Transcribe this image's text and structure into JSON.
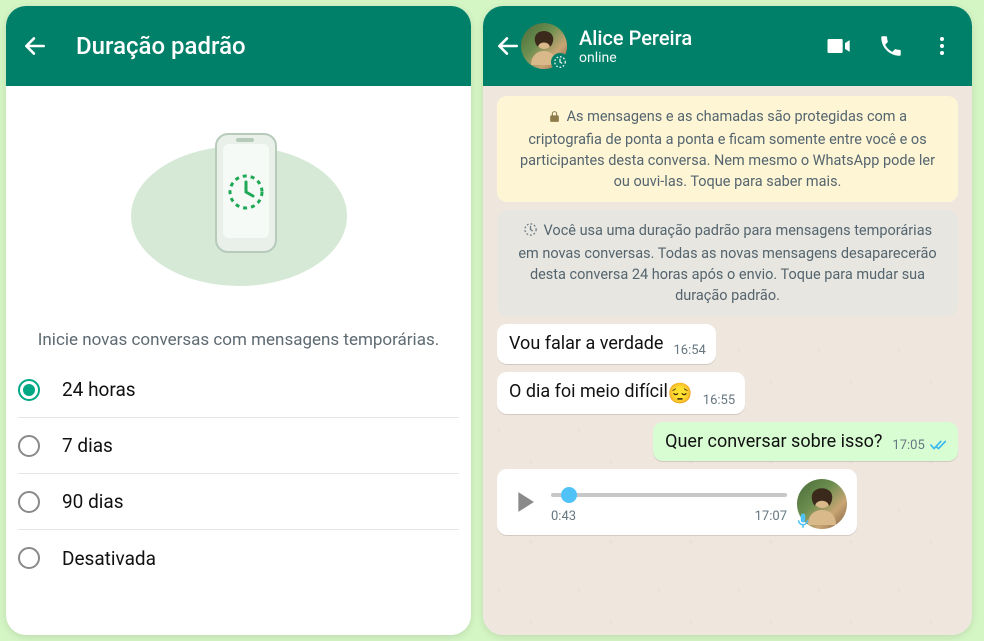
{
  "left": {
    "title": "Duração padrão",
    "subtitle": "Inicie novas conversas com mensagens temporárias.",
    "options": [
      {
        "label": "24 horas",
        "checked": true
      },
      {
        "label": "7 dias",
        "checked": false
      },
      {
        "label": "90 dias",
        "checked": false
      },
      {
        "label": "Desativada",
        "checked": false
      }
    ]
  },
  "right": {
    "contact": {
      "name": "Alice Pereira",
      "status": "online"
    },
    "encryption_banner": "As mensagens e as chamadas são protegidas com a criptografia de ponta a ponta e ficam somente entre você e os participantes desta conversa. Nem mesmo o WhatsApp pode ler ou ouvi-las. Toque para saber mais.",
    "timer_banner": "Você usa uma duração padrão para mensagens temporárias em novas conversas. Todas as novas mensagens desaparecerão desta conversa 24 horas após o envio. Toque para mudar sua duração padrão.",
    "messages": [
      {
        "dir": "in",
        "text": "Vou falar a verdade",
        "time": "16:54"
      },
      {
        "dir": "in",
        "text": "O dia foi meio difícil",
        "emoji": "😔",
        "time": "16:55"
      },
      {
        "dir": "out",
        "text": "Quer conversar sobre isso?",
        "time": "17:05",
        "ticks": true
      }
    ],
    "voice": {
      "duration": "0:43",
      "time": "17:07"
    }
  }
}
